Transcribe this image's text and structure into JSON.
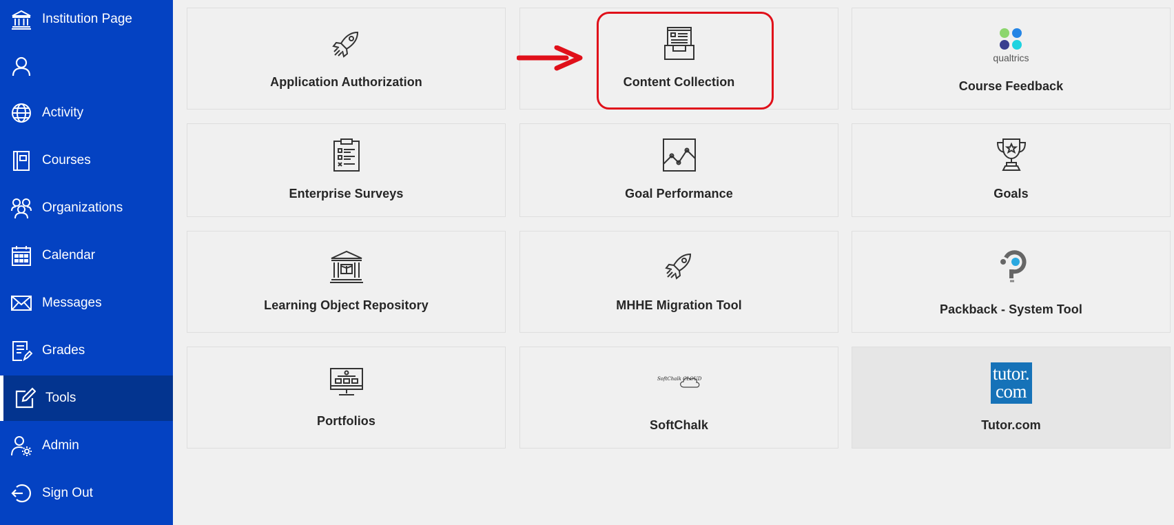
{
  "sidebar": {
    "items": [
      {
        "label": "Institution Page",
        "icon": "institution-icon"
      },
      {
        "label": "",
        "icon": "profile-icon"
      },
      {
        "label": "Activity",
        "icon": "globe-icon"
      },
      {
        "label": "Courses",
        "icon": "book-icon"
      },
      {
        "label": "Organizations",
        "icon": "people-icon"
      },
      {
        "label": "Calendar",
        "icon": "calendar-icon"
      },
      {
        "label": "Messages",
        "icon": "envelope-icon"
      },
      {
        "label": "Grades",
        "icon": "grades-icon"
      },
      {
        "label": "Tools",
        "icon": "edit-icon",
        "active": true
      },
      {
        "label": "Admin",
        "icon": "admin-gear-icon"
      },
      {
        "label": "Sign Out",
        "icon": "sign-out-icon"
      }
    ],
    "colors": {
      "background": "#0442c2",
      "active": "#03348f"
    }
  },
  "tools": [
    {
      "label": "Application Authorization",
      "icon": "rocket-icon"
    },
    {
      "label": "Content Collection",
      "icon": "content-collection-icon"
    },
    {
      "label": "Course Feedback",
      "icon": "qualtrics-logo-icon",
      "logo_text": "qualtrics"
    },
    {
      "label": "Enterprise Surveys",
      "icon": "clipboard-icon"
    },
    {
      "label": "Goal Performance",
      "icon": "line-chart-icon"
    },
    {
      "label": "Goals",
      "icon": "trophy-icon"
    },
    {
      "label": "Learning Object Repository",
      "icon": "repository-icon"
    },
    {
      "label": "MHHE Migration Tool",
      "icon": "rocket-icon"
    },
    {
      "label": "Packback - System Tool",
      "icon": "packback-logo-icon"
    },
    {
      "label": "Portfolios",
      "icon": "portfolio-icon"
    },
    {
      "label": "SoftChalk",
      "icon": "softchalk-logo-icon",
      "logo_text": "SoftChalk CLOUD"
    },
    {
      "label": "Tutor.com",
      "icon": "tutor-logo-icon",
      "logo_text": "tutor.com"
    }
  ],
  "annotation": {
    "color": "#e0101a",
    "target": "Content Collection"
  }
}
